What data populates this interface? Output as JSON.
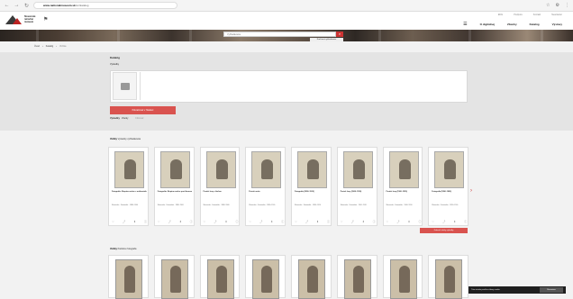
{
  "browser": {
    "url_host": "www.nationalmuseum.sk",
    "url_path": "/en/katalog"
  },
  "header": {
    "logo_text": "Slovenské národné múzeum",
    "top_links": [
      "ENG",
      "Podpora",
      "Kontakt",
      "Newsletter"
    ],
    "main_links": [
      "O digitálnej",
      "Zbierky",
      "Katalóg",
      "Výstavy"
    ],
    "search_placeholder": "Vyhľadávanie",
    "advanced_search": "Rozšírené vyhľadávanie"
  },
  "breadcrumb": {
    "items": [
      "Úvod",
      "Katalóg"
    ],
    "current": "Vizitka"
  },
  "panel": {
    "heading": "Katalóg",
    "subheading": "Výsledky",
    "button": "Pokračovať v hľadaní",
    "result_prefix": "Výsledky",
    "result_value": "Všetky",
    "result_note": "Filtrovať"
  },
  "section1": {
    "title_bold": "Vizitky",
    "title_rest": " Výsledky vyhľadávania"
  },
  "cards": [
    {
      "title": "Fotografia: Skupina mužov v uniformách",
      "meta": "Slovensko · Fotoateliér · 1880–1900"
    },
    {
      "title": "Fotografia: Skupina mužov pred domom",
      "meta": "Slovensko · Fotoateliér · 1880–1900"
    },
    {
      "title": "Portrét ženy v bielom",
      "meta": "Slovensko · Fotoateliér · 1880–1900"
    },
    {
      "title": "Portrét muža",
      "meta": "Slovensko · Fotoateliér · 1880–1900"
    },
    {
      "title": "Fotografia (1890–1910)",
      "meta": "Slovensko · Fotoateliér · 1890–1910"
    },
    {
      "title": "Portrét ženy (1900–1910)",
      "meta": "Slovensko · Fotoateliér · 1900–1910"
    },
    {
      "title": "Portrét ženy (1900–1910)",
      "meta": "Slovensko · Fotoateliér · 1900–1910"
    },
    {
      "title": "Fotografia (1890–1900)",
      "meta": "Slovensko · Fotoateliér · 1890–1900"
    }
  ],
  "show_more": "Zobraziť všetky výsledky",
  "section2": {
    "title_bold": "Vizitky",
    "title_rest": " Podobné fotografie"
  },
  "cookie": {
    "text": "Táto stránka používa súbory cookie.",
    "button": "Rozumiem"
  }
}
